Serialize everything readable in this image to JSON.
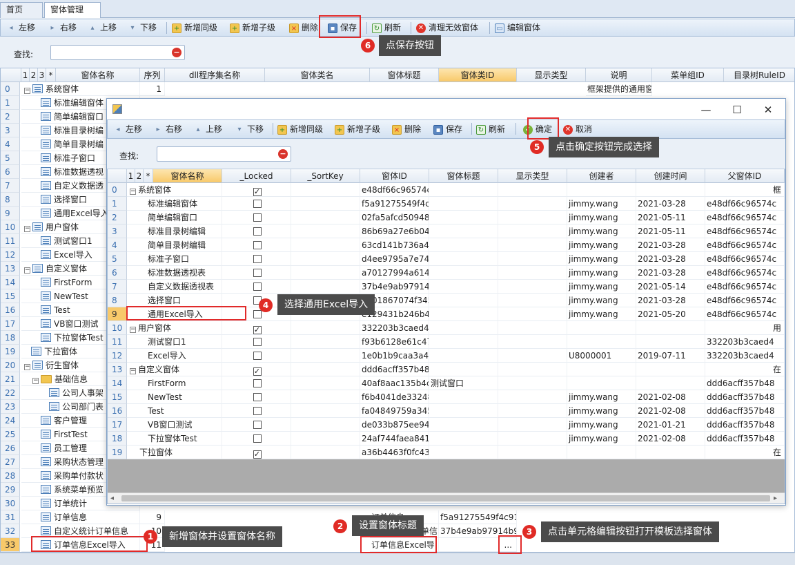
{
  "tabs": [
    {
      "label": "首页"
    },
    {
      "label": "窗体管理"
    }
  ],
  "main_toolbar": [
    "左移",
    "右移",
    "上移",
    "下移",
    "新增同级",
    "新增子级",
    "删除",
    "保存",
    "刷新",
    "清理无效窗体",
    "编辑窗体"
  ],
  "search_label": "查找:",
  "main_headers": [
    "1",
    "2",
    "3",
    "*",
    "窗体名称",
    "序列",
    "dll程序集名称",
    "窗体类名",
    "窗体标题",
    "窗体类ID",
    "显示类型",
    "说明",
    "菜单组ID",
    "目录树RuleID"
  ],
  "main_rows": [
    {
      "n": "0",
      "name": "系统窗体",
      "seq": "1",
      "desc": "框架提供的通用窗"
    },
    {
      "n": "1",
      "name": "标准编辑窗体"
    },
    {
      "n": "2",
      "name": "简单编辑窗口"
    },
    {
      "n": "3",
      "name": "标准目录树编"
    },
    {
      "n": "4",
      "name": "简单目录树编"
    },
    {
      "n": "5",
      "name": "标准子窗口"
    },
    {
      "n": "6",
      "name": "标准数据透视"
    },
    {
      "n": "7",
      "name": "自定义数据透"
    },
    {
      "n": "8",
      "name": "选择窗口"
    },
    {
      "n": "9",
      "name": "通用Excel导入"
    },
    {
      "n": "10",
      "name": "用户窗体"
    },
    {
      "n": "11",
      "name": "测试窗口1"
    },
    {
      "n": "12",
      "name": "Excel导入"
    },
    {
      "n": "13",
      "name": "自定义窗体"
    },
    {
      "n": "14",
      "name": "FirstForm"
    },
    {
      "n": "15",
      "name": "NewTest"
    },
    {
      "n": "16",
      "name": "Test"
    },
    {
      "n": "17",
      "name": "VB窗口测试"
    },
    {
      "n": "18",
      "name": "下拉窗体Test"
    },
    {
      "n": "19",
      "name": "下拉窗体"
    },
    {
      "n": "20",
      "name": "衍生窗体"
    },
    {
      "n": "21",
      "name": "基础信息"
    },
    {
      "n": "22",
      "name": "公司人事架"
    },
    {
      "n": "23",
      "name": "公司部门表"
    },
    {
      "n": "24",
      "name": "客户管理"
    },
    {
      "n": "25",
      "name": "FirstTest"
    },
    {
      "n": "26",
      "name": "员工管理"
    },
    {
      "n": "27",
      "name": "采购状态管理"
    },
    {
      "n": "28",
      "name": "采购单付款状"
    },
    {
      "n": "29",
      "name": "系统菜单预览"
    },
    {
      "n": "30",
      "name": "订单统计"
    },
    {
      "n": "31",
      "name": "订单信息",
      "seq": "9",
      "title": "订单信息",
      "clsid": "f5a91275549f4c91"
    },
    {
      "n": "32",
      "name": "自定义统计订单信息",
      "seq": "10",
      "title": "自定义统计订单信",
      "clsid": "37b4e9ab97914b9"
    },
    {
      "n": "33",
      "name": "订单信息Excel导入",
      "seq": "11",
      "title": "订单信息Excel导",
      "clsid": "..."
    }
  ],
  "dialog": {
    "toolbar": [
      "左移",
      "右移",
      "上移",
      "下移",
      "新增同级",
      "新增子级",
      "删除",
      "保存",
      "刷新",
      "确定",
      "取消"
    ],
    "search_label": "查找:",
    "headers": [
      "1",
      "2",
      "*",
      "窗体名称",
      "_Locked",
      "_SortKey",
      "窗体ID",
      "窗体标题",
      "显示类型",
      "创建者",
      "创建时间",
      "父窗体ID"
    ],
    "rows": [
      {
        "n": "0",
        "name": "系统窗体",
        "lock": true,
        "id": "e48df66c96574c",
        "title": "",
        "creator": "",
        "time": "",
        "parent": "框"
      },
      {
        "n": "1",
        "name": "标准编辑窗体",
        "lock": false,
        "id": "f5a91275549f4c9",
        "title": "",
        "creator": "jimmy.wang",
        "time": "2021-03-28",
        "parent": "e48df66c96574c"
      },
      {
        "n": "2",
        "name": "简单编辑窗口",
        "lock": false,
        "id": "02fa5afcd509488",
        "title": "",
        "creator": "jimmy.wang",
        "time": "2021-05-11",
        "parent": "e48df66c96574c"
      },
      {
        "n": "3",
        "name": "标准目录树编辑",
        "lock": false,
        "id": "86b69a27e6b04",
        "title": "",
        "creator": "jimmy.wang",
        "time": "2021-05-11",
        "parent": "e48df66c96574c"
      },
      {
        "n": "4",
        "name": "简单目录树编辑",
        "lock": false,
        "id": "63cd141b736a4",
        "title": "",
        "creator": "jimmy.wang",
        "time": "2021-03-28",
        "parent": "e48df66c96574c"
      },
      {
        "n": "5",
        "name": "标准子窗口",
        "lock": false,
        "id": "d4ee9795a7e74",
        "title": "",
        "creator": "jimmy.wang",
        "time": "2021-03-28",
        "parent": "e48df66c96574c"
      },
      {
        "n": "6",
        "name": "标准数据透视表",
        "lock": false,
        "id": "a70127994a614",
        "title": "",
        "creator": "jimmy.wang",
        "time": "2021-03-28",
        "parent": "e48df66c96574c"
      },
      {
        "n": "7",
        "name": "自定义数据透视表",
        "lock": false,
        "id": "37b4e9ab97914",
        "title": "",
        "creator": "jimmy.wang",
        "time": "2021-05-14",
        "parent": "e48df66c96574c"
      },
      {
        "n": "8",
        "name": "选择窗口",
        "lock": false,
        "id": "e501867074f345",
        "title": "",
        "creator": "jimmy.wang",
        "time": "2021-03-28",
        "parent": "e48df66c96574c"
      },
      {
        "n": "9",
        "name": "通用Excel导入",
        "lock": false,
        "id": "e129431b246b4",
        "title": "",
        "creator": "jimmy.wang",
        "time": "2021-05-20",
        "parent": "e48df66c96574c"
      },
      {
        "n": "10",
        "name": "用户窗体",
        "lock": true,
        "id": "332203b3caed4",
        "title": "",
        "creator": "",
        "time": "",
        "parent": "用"
      },
      {
        "n": "11",
        "name": "测试窗口1",
        "lock": false,
        "id": "f93b6128e61c47",
        "title": "",
        "creator": "",
        "time": "",
        "parent": "332203b3caed4"
      },
      {
        "n": "12",
        "name": "Excel导入",
        "lock": false,
        "id": "1e0b1b9caa3a4",
        "title": "",
        "creator": "U8000001",
        "time": "2019-07-11",
        "parent": "332203b3caed4"
      },
      {
        "n": "13",
        "name": "自定义窗体",
        "lock": true,
        "id": "ddd6acff357b48",
        "title": "",
        "creator": "",
        "time": "",
        "parent": "在"
      },
      {
        "n": "14",
        "name": "FirstForm",
        "lock": false,
        "id": "40af8aac135b4c",
        "title": "测试窗口",
        "creator": "",
        "time": "",
        "parent": "ddd6acff357b48"
      },
      {
        "n": "15",
        "name": "NewTest",
        "lock": false,
        "id": "f6b4041de33248",
        "title": "",
        "creator": "jimmy.wang",
        "time": "2021-02-08",
        "parent": "ddd6acff357b48"
      },
      {
        "n": "16",
        "name": "Test",
        "lock": false,
        "id": "fa04849759a345",
        "title": "",
        "creator": "jimmy.wang",
        "time": "2021-02-08",
        "parent": "ddd6acff357b48"
      },
      {
        "n": "17",
        "name": "VB窗口测试",
        "lock": false,
        "id": "de033b875ee94",
        "title": "",
        "creator": "jimmy.wang",
        "time": "2021-01-21",
        "parent": "ddd6acff357b48"
      },
      {
        "n": "18",
        "name": "下拉窗体Test",
        "lock": false,
        "id": "24af744faea841",
        "title": "",
        "creator": "jimmy.wang",
        "time": "2021-02-08",
        "parent": "ddd6acff357b48"
      },
      {
        "n": "19",
        "name": "下拉窗体",
        "lock": true,
        "id": "a36b4463f0fc43",
        "title": "",
        "creator": "",
        "time": "",
        "parent": "在"
      }
    ]
  },
  "callouts": {
    "c1": {
      "num": "1",
      "text": "新增窗体并设置窗体名称"
    },
    "c2": {
      "num": "2",
      "text": "设置窗体标题"
    },
    "c3": {
      "num": "3",
      "text": "点击单元格编辑按钮打开模板选择窗体"
    },
    "c4": {
      "num": "4",
      "text": "选择通用Excel导入"
    },
    "c5": {
      "num": "5",
      "text": "点击确定按钮完成选择"
    },
    "c6": {
      "num": "6",
      "text": "点保存按钮"
    }
  }
}
